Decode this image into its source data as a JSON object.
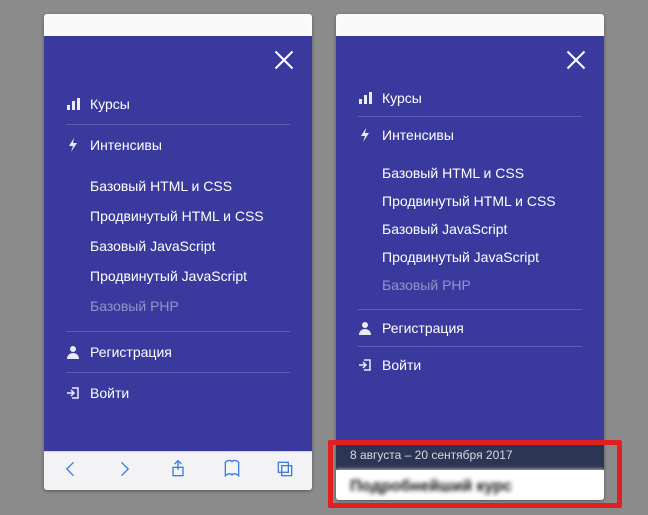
{
  "menu": {
    "courses": "Курсы",
    "intensives": "Интенсивы",
    "items": [
      {
        "label": "Базовый HTML и CSS",
        "disabled": false
      },
      {
        "label": "Продвинутый HTML и CSS",
        "disabled": false
      },
      {
        "label": "Базовый JavaScript",
        "disabled": false
      },
      {
        "label": "Продвинутый JavaScript",
        "disabled": false
      },
      {
        "label": "Базовый PHP",
        "disabled": true
      }
    ],
    "register": "Регистрация",
    "login": "Войти"
  },
  "peek": {
    "dates": "8 августа – 20 сентября 2017",
    "card_title": "Подробнейший курс"
  }
}
